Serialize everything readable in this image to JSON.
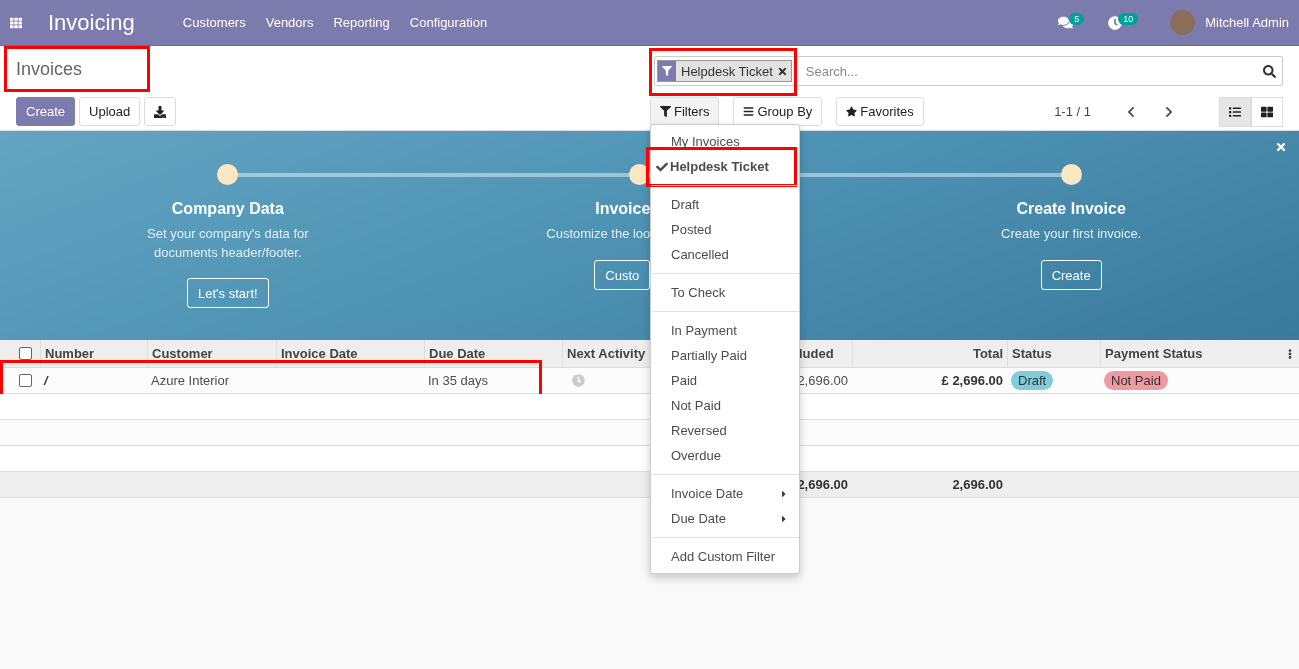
{
  "navbar": {
    "app_title": "Invoicing",
    "menu": [
      "Customers",
      "Vendors",
      "Reporting",
      "Configuration"
    ],
    "messages_count": "5",
    "activities_count": "10",
    "user": "Mitchell Admin"
  },
  "control_panel": {
    "breadcrumb": {
      "label": "Invoices",
      "highlighted": true
    },
    "buttons": [
      {
        "label": "Create",
        "kind": "primary"
      },
      {
        "label": "Upload",
        "kind": "secondary"
      }
    ],
    "search": {
      "facets": [
        {
          "label": "Helpdesk Ticket",
          "highlighted": true
        }
      ],
      "placeholder": "Search..."
    },
    "search_options": [
      {
        "label": "Filters",
        "kind": "filter",
        "expanded": true
      },
      {
        "label": "Group By",
        "kind": "group",
        "expanded": false
      },
      {
        "label": "Favorites",
        "kind": "favorite",
        "expanded": false
      }
    ],
    "pager": "1-1 / 1",
    "views": [
      {
        "kind": "list",
        "selected": true
      },
      {
        "kind": "kanban",
        "selected": false
      }
    ]
  },
  "filters_menu": {
    "groups": [
      [
        {
          "label": "My Invoices",
          "checked": false,
          "highlighted": false
        },
        {
          "label": "Helpdesk Ticket",
          "checked": true,
          "highlighted": true
        }
      ],
      [
        {
          "label": "Draft",
          "checked": false,
          "highlighted": false
        },
        {
          "label": "Posted",
          "checked": false,
          "highlighted": false
        },
        {
          "label": "Cancelled",
          "checked": false,
          "highlighted": false
        }
      ],
      [
        {
          "label": "To Check",
          "checked": false,
          "highlighted": false
        }
      ],
      [
        {
          "label": "In Payment",
          "checked": false,
          "highlighted": false
        },
        {
          "label": "Partially Paid",
          "checked": false,
          "highlighted": false
        },
        {
          "label": "Paid",
          "checked": false,
          "highlighted": false
        },
        {
          "label": "Not Paid",
          "checked": false,
          "highlighted": false
        },
        {
          "label": "Reversed",
          "checked": false,
          "highlighted": false
        },
        {
          "label": "Overdue",
          "checked": false,
          "highlighted": false
        }
      ],
      [
        {
          "label": "Invoice Date",
          "checked": false,
          "highlighted": false,
          "has_submenu": true
        },
        {
          "label": "Due Date",
          "checked": false,
          "highlighted": false,
          "has_submenu": true
        }
      ],
      [
        {
          "label": "Add Custom Filter",
          "checked": false,
          "highlighted": false
        }
      ]
    ]
  },
  "onboarding": {
    "steps": [
      {
        "title": "Company Data",
        "description": "Set your company's data for documents header/footer.",
        "button": "Let's start!",
        "overlapped": false
      },
      {
        "title": "Invoice",
        "description": "Customize the loo",
        "button": "Custo",
        "overlapped": true
      },
      {
        "title": "Create Invoice",
        "description": "Create your first invoice.",
        "button": "Create",
        "overlapped": false
      }
    ]
  },
  "table": {
    "columns": [
      "Number",
      "Customer",
      "Invoice Date",
      "Due Date",
      "Next Activity",
      "luded",
      "Total",
      "Status",
      "Payment Status"
    ],
    "rows": [
      {
        "checked": false,
        "highlighted": true,
        "number": "/",
        "customer": "Azure Interior",
        "due_date": "In 35 days",
        "tax_included": "2,696.00",
        "total": "£ 2,696.00",
        "status": {
          "label": "Draft",
          "kind": "draft"
        },
        "payment_status": {
          "label": "Not Paid",
          "kind": "not_paid"
        }
      }
    ],
    "all_selected": false,
    "footer": {
      "tax_included": "2,696.00",
      "total": "2,696.00"
    }
  }
}
